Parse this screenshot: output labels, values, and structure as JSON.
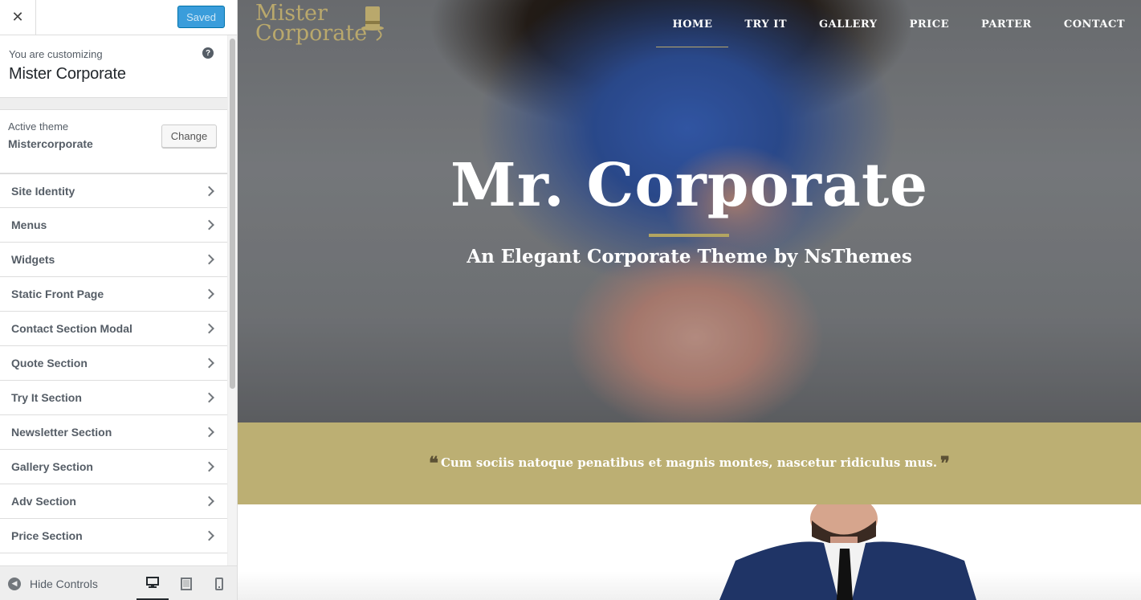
{
  "customizer": {
    "close_label": "✕",
    "saved_label": "Saved",
    "info": {
      "pre_label": "You are customizing",
      "site_title": "Mister Corporate",
      "help_glyph": "?"
    },
    "theme": {
      "label": "Active theme",
      "name": "Mistercorporate",
      "change_label": "Change"
    },
    "sections": [
      "Site Identity",
      "Menus",
      "Widgets",
      "Static Front Page",
      "Contact Section Modal",
      "Quote Section",
      "Try It Section",
      "Newsletter Section",
      "Gallery Section",
      "Adv Section",
      "Price Section"
    ],
    "footer": {
      "hide_label": "Hide Controls",
      "devices": [
        "desktop",
        "tablet",
        "mobile"
      ],
      "active_device": "desktop"
    }
  },
  "preview": {
    "logo_line1": "Mister",
    "logo_line2": "Corporate",
    "nav": [
      "HOME",
      "TRY IT",
      "GALLERY",
      "PRICE",
      "PARTER",
      "CONTACT"
    ],
    "active_nav": "HOME",
    "hero_title": "Mr. Corporate",
    "hero_subtitle": "An Elegant Corporate Theme by NsThemes",
    "quote_open": "❝",
    "quote": "Cum sociis natoque penatibus et magnis montes, nascetur ridiculus mus.",
    "quote_close": "❞"
  },
  "colors": {
    "accent_blue": "#3a9ddb",
    "brand_gold": "#b9a86c",
    "quote_band": "#bcaf73",
    "quote_marks": "#5c5135"
  }
}
